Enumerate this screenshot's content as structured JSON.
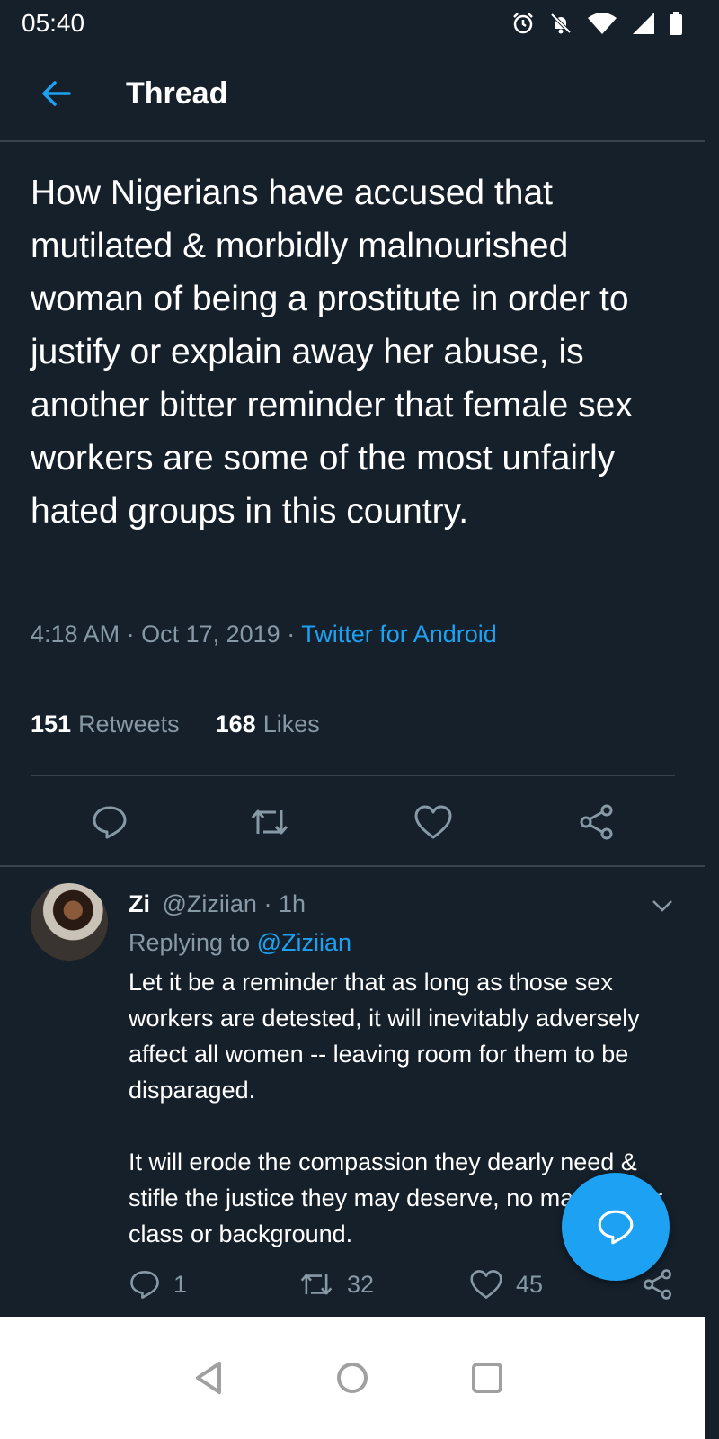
{
  "status_bar": {
    "time": "05:40"
  },
  "header": {
    "title": "Thread"
  },
  "tweet": {
    "text": "How Nigerians have accused that mutilated & morbidly malnourished woman of being a prostitute in order to justify or explain away her abuse, is another bitter reminder that female sex workers are some of the most unfairly hated groups in this country.",
    "time": "4:18 AM",
    "date": "Oct 17, 2019",
    "source": "Twitter for Android",
    "retweets_count": "151",
    "retweets_label": "Retweets",
    "likes_count": "168",
    "likes_label": "Likes"
  },
  "reply": {
    "name": "Zi",
    "handle": "@Ziziian",
    "age": "1h",
    "replying_prefix": "Replying to",
    "replying_to": "@Ziziian",
    "paragraph1": "Let it be a reminder that as long as those sex workers are detested, it will inevitably adversely affect all women -- leaving room for them to be disparaged.",
    "paragraph2": "It will erode the compassion they dearly need & stifle the justice they may deserve, no matter their class or background.",
    "reply_count": "1",
    "retweet_count": "32",
    "like_count": "45"
  },
  "colors": {
    "background": "#15202b",
    "accent": "#1da1f2",
    "muted": "#8899a6",
    "divider": "#38444d"
  },
  "icons": [
    "alarm-icon",
    "bell-off-icon",
    "wifi-icon",
    "signal-icon",
    "battery-icon",
    "back-arrow-icon",
    "reply-icon",
    "retweet-icon",
    "like-icon",
    "share-icon",
    "chevron-down-icon",
    "compose-reply-icon",
    "nav-back-icon",
    "nav-home-icon",
    "nav-recents-icon"
  ]
}
